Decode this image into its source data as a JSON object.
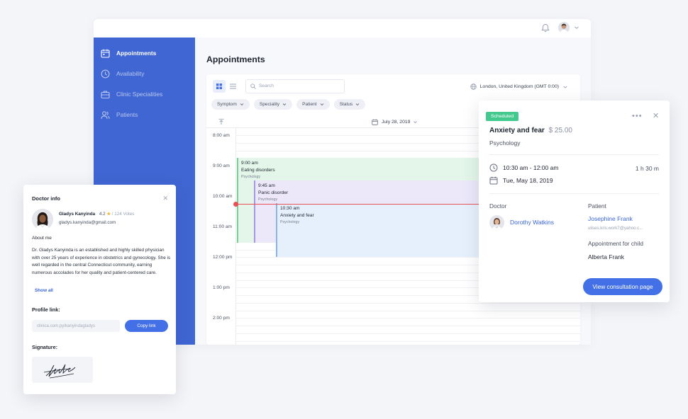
{
  "sidebar": {
    "items": [
      {
        "label": "Appointments",
        "icon": "calendar-icon",
        "active": true
      },
      {
        "label": "Availability",
        "icon": "clock-icon"
      },
      {
        "label": "Clinic Specialities",
        "icon": "briefcase-icon"
      },
      {
        "label": "Patients",
        "icon": "users-icon"
      }
    ]
  },
  "main": {
    "title": "Appointments",
    "search_placeholder": "Search",
    "timezone": "London, United Kingdom (GMT 0:00)",
    "filters": [
      "Symptom",
      "Speciality",
      "Patient",
      "Status"
    ],
    "date": "July 28, 2019",
    "time_slots": [
      "8:00 am",
      "9:00 am",
      "10:00 am",
      "11:00 am",
      "12:00 pm",
      "1:00 pm",
      "2:00 pm"
    ],
    "events": [
      {
        "time": "9:00 am",
        "title": "Eating disorders",
        "category": "Psychology"
      },
      {
        "time": "9:45 am",
        "title": "Panic disorder",
        "category": "Psychology"
      },
      {
        "time": "10:30 am",
        "title": "Anxiety and fear",
        "category": "Psychology"
      }
    ]
  },
  "doctor_card": {
    "title": "Doctor info",
    "name": "Gladys Kanyinda",
    "rating": "4.2",
    "votes": "/ 124 Votes",
    "email": "gladys.kanyinda@gmail.com",
    "about_label": "About me",
    "about_text": "Dr. Gladys Kanyinda is an established and highly skilled physician with over 25 years of experience in obstetrics and gynecology. She is well regarded in the central Connecticut community, earning numerous accolades for her quality and patient-centered care.",
    "show_all": "Show all",
    "profile_link_label": "Profile link:",
    "profile_link_value": "clinica.com.py/kanyindagladys",
    "copy_label": "Copy link",
    "signature_label": "Signature:"
  },
  "appointment_card": {
    "status": "Scheduled",
    "title": "Anxiety and fear",
    "price": "$ 25.00",
    "category": "Psychology",
    "time_range": "10:30 am - 12:00 am",
    "duration": "1 h 30 m",
    "date": "Tue, May 18, 2019",
    "doctor_label": "Doctor",
    "doctor_name": "Dorothy Watkins",
    "patient_label": "Patient",
    "patient_name": "Josephine Frank",
    "patient_email": "ulises.kris.work7@yahoo.c...",
    "child_label": "Appointment for child",
    "child_name": "Alberta Frank",
    "button_label": "View consultation page"
  },
  "colors": {
    "sidebar": "#4066d3",
    "accent": "#4370e6",
    "scheduled": "#43c98d",
    "now_line": "#ea4f57"
  }
}
